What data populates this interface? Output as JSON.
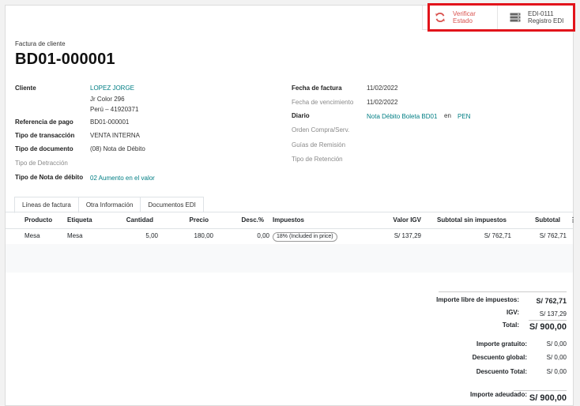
{
  "smart_buttons": {
    "verify": {
      "line1": "Verificar",
      "line2": "Estado",
      "color": "#d9534f",
      "icon": "refresh-icon"
    },
    "edi": {
      "line1": "EDI-0111",
      "line2": "Registro EDI",
      "icon": "server-icon"
    }
  },
  "header": {
    "subtitle": "Factura de cliente",
    "title": "BD01-000001"
  },
  "left_fields": {
    "cliente_label": "Cliente",
    "cliente_name": "LOPEZ JORGE",
    "cliente_addr1": "Jr Color 296",
    "cliente_addr2": "Perú – 41920371",
    "ref_label": "Referencia de pago",
    "ref_value": "BD01-000001",
    "trans_label": "Tipo de transacción",
    "trans_value": "VENTA INTERNA",
    "doc_label": "Tipo de documento",
    "doc_value": "(08) Nota de Débito",
    "detr_label": "Tipo de Detracción",
    "nota_label": "Tipo de Nota de débito",
    "nota_value": "02 Aumento en el valor"
  },
  "right_fields": {
    "fecha_label": "Fecha de factura",
    "fecha_value": "11/02/2022",
    "venc_label": "Fecha de vencimiento",
    "venc_value": "11/02/2022",
    "diario_label": "Diario",
    "diario_value": "Nota Débito Boleta BD01",
    "en": "en",
    "currency": "PEN",
    "orden_label": "Orden Compra/Serv.",
    "guias_label": "Guías de Remisión",
    "ret_label": "Tipo de Retención"
  },
  "tabs": [
    "Líneas de factura",
    "Otra Información",
    "Documentos EDI"
  ],
  "table": {
    "headers": [
      "Producto",
      "Etiqueta",
      "Cantidad",
      "Precio",
      "Desc.%",
      "Impuestos",
      "Valor IGV",
      "Subtotal sin impuestos",
      "Subtotal"
    ],
    "row": [
      "Mesa",
      "Mesa",
      "5,00",
      "180,00",
      "0,00",
      "18% (Included in price)",
      "S/ 137,29",
      "S/ 762,71",
      "S/ 762,71"
    ]
  },
  "totals": {
    "libre_label": "Importe libre de impuestos:",
    "libre_value": "S/ 762,71",
    "igv_label": "IGV:",
    "igv_value": "S/ 137,29",
    "total_label": "Total:",
    "total_value": "S/ 900,00",
    "gratuito_label": "Importe gratuito:",
    "gratuito_value": "S/ 0,00",
    "global_label": "Descuento global:",
    "global_value": "S/ 0,00",
    "desc_total_label": "Descuento Total:",
    "desc_total_value": "S/ 0,00",
    "adeudado_label": "Importe adeudado:",
    "adeudado_value": "S/ 900,00"
  }
}
